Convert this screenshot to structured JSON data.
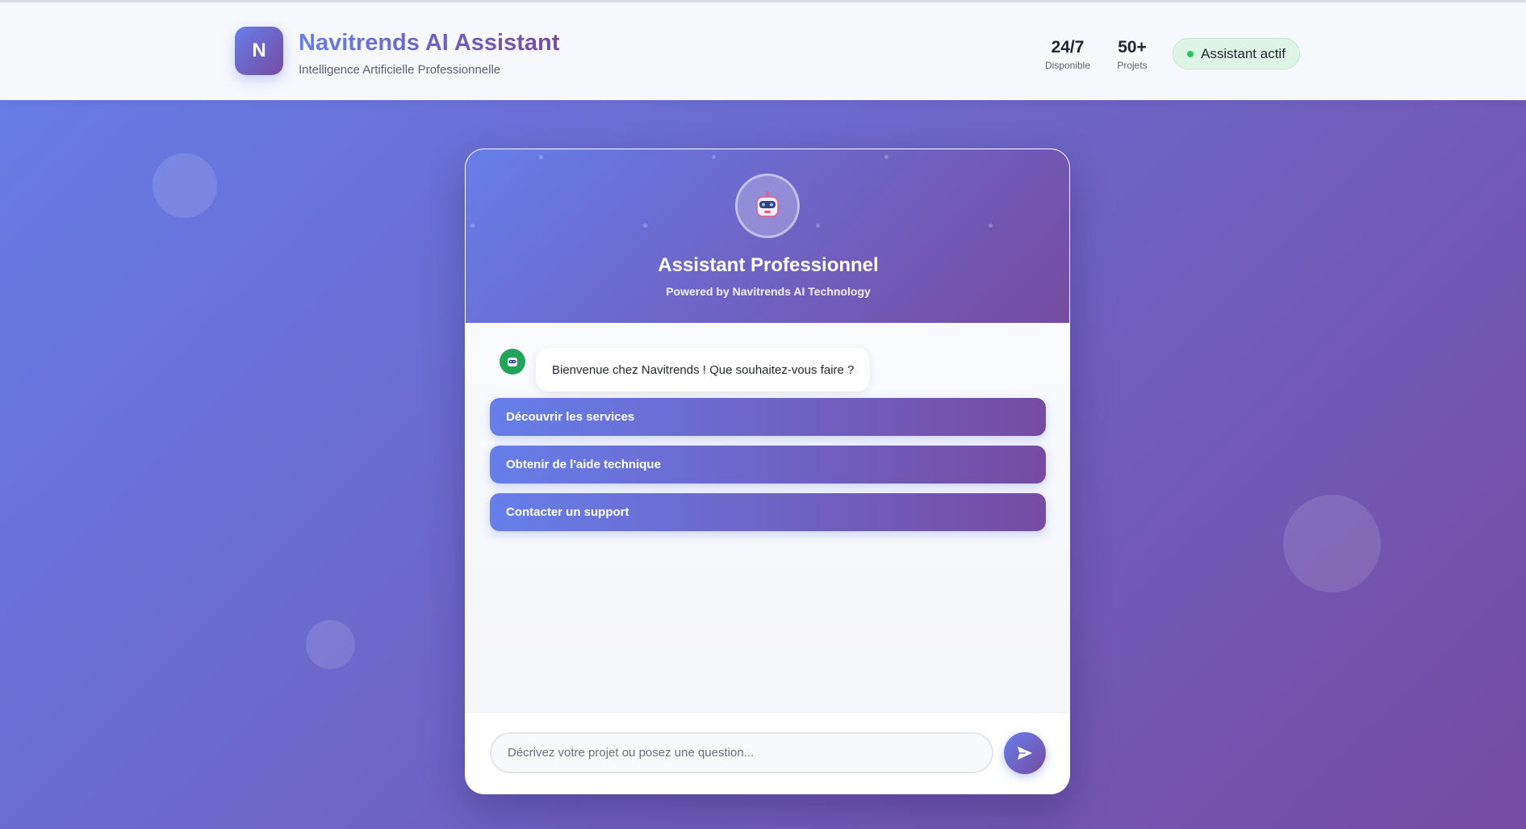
{
  "header": {
    "logo_letter": "N",
    "title": "Navitrends AI Assistant",
    "subtitle": "Intelligence Artificielle Professionnelle",
    "stats": [
      {
        "value": "24/7",
        "label": "Disponible"
      },
      {
        "value": "50+",
        "label": "Projets"
      }
    ],
    "status": "Assistant actif"
  },
  "chat": {
    "avatar_icon": "robot-icon",
    "title": "Assistant Professionnel",
    "subtitle": "Powered by Navitrends AI Technology",
    "messages": [
      {
        "from": "bot",
        "text": "Bienvenue chez Navitrends ! Que souhaitez-vous faire ?"
      }
    ],
    "options": [
      {
        "label": "Découvrir les services"
      },
      {
        "label": "Obtenir de l'aide technique"
      },
      {
        "label": "Contacter un support"
      }
    ],
    "input": {
      "value": "",
      "placeholder": "Décrivez votre projet ou posez une question..."
    },
    "send_icon": "send-icon"
  },
  "colors": {
    "gradient_start": "#667eea",
    "gradient_end": "#764ba2",
    "status_dot": "#22c55e"
  }
}
